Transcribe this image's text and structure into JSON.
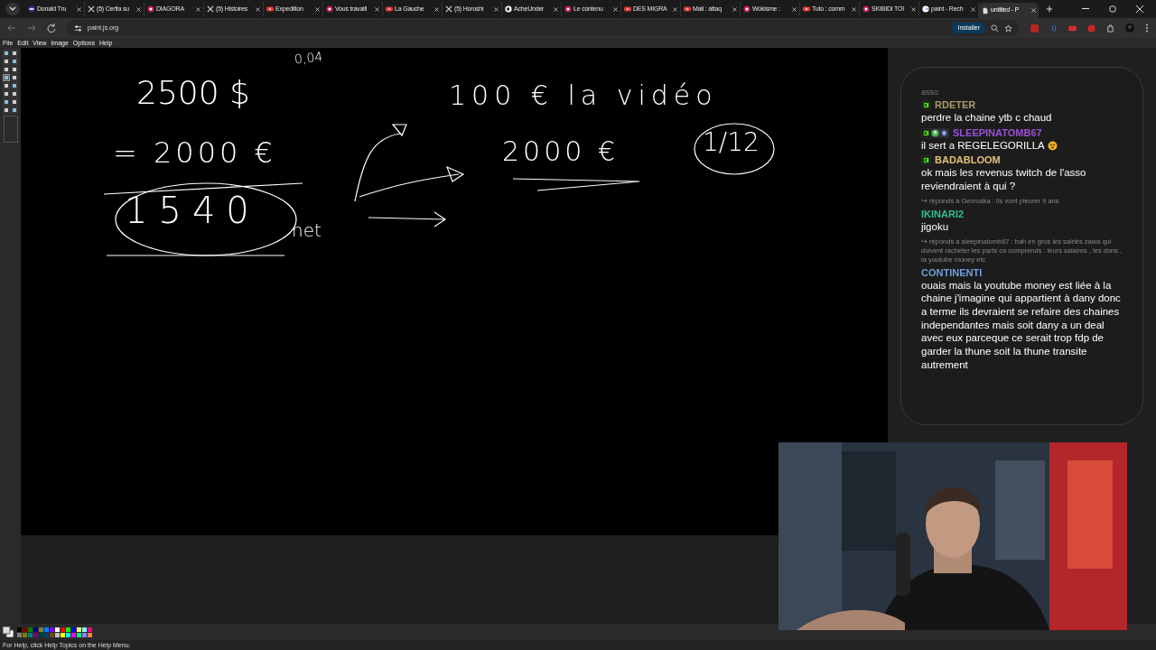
{
  "browser": {
    "tabs": [
      {
        "title": "Donald Tru",
        "selected": false
      },
      {
        "title": "(5) Cerfia su",
        "selected": false
      },
      {
        "title": "DIAGORA",
        "selected": false
      },
      {
        "title": "(5) Histoires",
        "selected": false
      },
      {
        "title": "Expedition",
        "selected": false
      },
      {
        "title": "Vous travaill",
        "selected": false
      },
      {
        "title": "La Gauche",
        "selected": false
      },
      {
        "title": "(5) Horoshi",
        "selected": false
      },
      {
        "title": "AcheUnder",
        "selected": false
      },
      {
        "title": "Le contenu",
        "selected": false
      },
      {
        "title": "DES MIGRA",
        "selected": false
      },
      {
        "title": "Mali : attaq",
        "selected": false
      },
      {
        "title": "Wokisme :",
        "selected": false
      },
      {
        "title": "Tuto : comm",
        "selected": false
      },
      {
        "title": "SKIBIDI TOI",
        "selected": false
      },
      {
        "title": "paint - Rech",
        "selected": false
      },
      {
        "title": "untitled - P",
        "selected": true
      }
    ],
    "address": "paint.js.org",
    "install_button": "Installer"
  },
  "app": {
    "menu": [
      "File",
      "Edit",
      "View",
      "Image",
      "Options",
      "Help"
    ],
    "tools": [
      {
        "selected": false
      },
      {
        "selected": false
      },
      {
        "selected": false
      },
      {
        "selected": false
      },
      {
        "selected": false
      },
      {
        "selected": false
      },
      {
        "selected": true
      },
      {
        "selected": false
      },
      {
        "selected": false
      },
      {
        "selected": false
      },
      {
        "selected": false
      },
      {
        "selected": false
      },
      {
        "selected": false
      },
      {
        "selected": false
      },
      {
        "selected": false
      },
      {
        "selected": false
      }
    ],
    "canvas_notes": [
      "0,04",
      "2500 $",
      "100 € la vidéo",
      "= 2000 €",
      "2000 €",
      "1/12",
      "1540",
      "net"
    ],
    "palette": [
      {
        "color": "#000000"
      },
      {
        "color": "#808080"
      },
      {
        "color": "#800000"
      },
      {
        "color": "#808000"
      },
      {
        "color": "#008000"
      },
      {
        "color": "#008080"
      },
      {
        "color": "#000080"
      },
      {
        "color": "#800080"
      },
      {
        "color": "#808040"
      },
      {
        "color": "#004040"
      },
      {
        "color": "#0080ff"
      },
      {
        "color": "#004080"
      },
      {
        "color": "#8000ff"
      },
      {
        "color": "#804000"
      },
      {
        "color": "#ffffff"
      },
      {
        "color": "#c0c0c0"
      },
      {
        "color": "#ff0000"
      },
      {
        "color": "#ffff00"
      },
      {
        "color": "#00ff00"
      },
      {
        "color": "#00ffff"
      },
      {
        "color": "#0000ff"
      },
      {
        "color": "#ff00ff"
      },
      {
        "color": "#ffff80"
      },
      {
        "color": "#00ff80"
      },
      {
        "color": "#80ffff"
      },
      {
        "color": "#8080ff"
      },
      {
        "color": "#ff0080"
      },
      {
        "color": "#ff8040"
      }
    ],
    "status": "For Help, click Help Topics on the Help Menu."
  },
  "chat": {
    "faded_line": "asso",
    "messages": [
      {
        "user": "RDETER",
        "color": "#a59d6a",
        "text": "perdre la chaine ytb c chaud"
      },
      {
        "user": "SLEEPINATOMB67",
        "color": "#9b4fd6",
        "text": "il sert a REGELEGORILLA"
      },
      {
        "user": "BADABLOOM",
        "color": "#e2c17a",
        "text": "ok mais les revenus twitch de l'asso reviendraient à qui ?"
      },
      {
        "reply": "↪ réponds à Gevroska : Ils vont pleurer 9 ans",
        "user": "IKINARI2",
        "color": "#2fbf8f",
        "text": "jigoku"
      },
      {
        "reply": "↪ réponds à sleepinatomb67 : bah en gros les salriés zawa qui doivent racheter les parts ca comprends : leurs salaires , les dons , la youtube money etc",
        "user": "CONTINENTI",
        "color": "#6f9fd8",
        "text": "ouais mais la youtube money est liée à la chaine j'imagine qui appartient à dany donc a terme ils devraient se refaire des chaines independantes mais soit dany a un deal avec eux parceque ce serait trop fdp de garder la thune soit la thune transite autrement"
      }
    ]
  }
}
